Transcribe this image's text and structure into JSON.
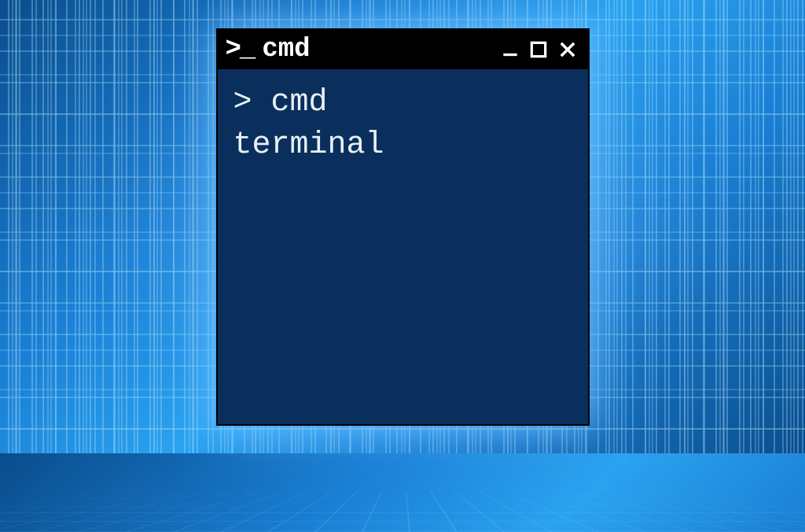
{
  "window": {
    "title": "cmd",
    "icon_name": "prompt-icon"
  },
  "terminal": {
    "lines": [
      {
        "prompt": "> ",
        "text": "cmd"
      },
      {
        "prompt": "",
        "text": "terminal"
      }
    ]
  },
  "colors": {
    "titlebar_bg": "#000000",
    "terminal_bg": "#0a2f5c",
    "text": "#e8f0f5",
    "accent_glow": "#78c8ff"
  }
}
